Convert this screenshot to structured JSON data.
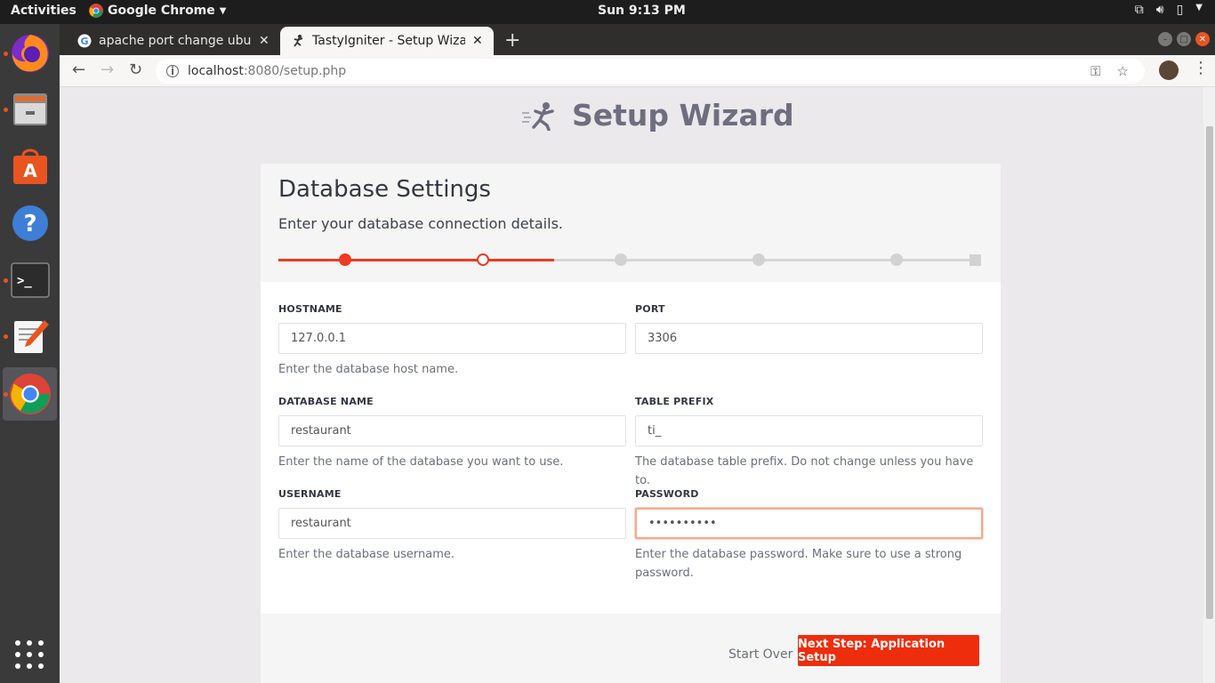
{
  "topbar": {
    "activities": "Activities",
    "app_name": "Google Chrome",
    "clock": "Sun  9:13 PM"
  },
  "dock": {
    "items": [
      "firefox",
      "files",
      "software-center",
      "help",
      "terminal",
      "text-editor",
      "chrome"
    ]
  },
  "browser": {
    "tabs": [
      {
        "title": "apache port change ubun",
        "icon": "google-icon"
      },
      {
        "title": "TastyIgniter - Setup Wizar",
        "icon": "tastyigniter-icon"
      }
    ],
    "url_host": "localhost",
    "url_rest": ":8080/setup.php"
  },
  "page": {
    "brand_title": "Setup Wizard",
    "card_title": "Database Settings",
    "card_subtitle": "Enter your database connection details.",
    "progress": {
      "steps": 6,
      "completed": 1,
      "current": 2
    },
    "fields": {
      "hostname": {
        "label": "HOSTNAME",
        "value": "127.0.0.1",
        "help": "Enter the database host name."
      },
      "port": {
        "label": "PORT",
        "value": "3306",
        "help": ""
      },
      "database": {
        "label": "DATABASE NAME",
        "value": "restaurant",
        "help": "Enter the name of the database you want to use."
      },
      "prefix": {
        "label": "TABLE PREFIX",
        "value": "ti_",
        "help": "The database table prefix. Do not change unless you have to."
      },
      "username": {
        "label": "USERNAME",
        "value": "restaurant",
        "help": "Enter the database username."
      },
      "password": {
        "label": "PASSWORD",
        "value": "••••••••••",
        "help": "Enter the database password. Make sure to use a strong password."
      }
    },
    "start_over": "Start Over",
    "next_button": "Next Step: Application Setup"
  },
  "colors": {
    "accent": "#ee2d0c",
    "progress": "#ee3a22",
    "ubuntu_orange": "#e95420"
  }
}
